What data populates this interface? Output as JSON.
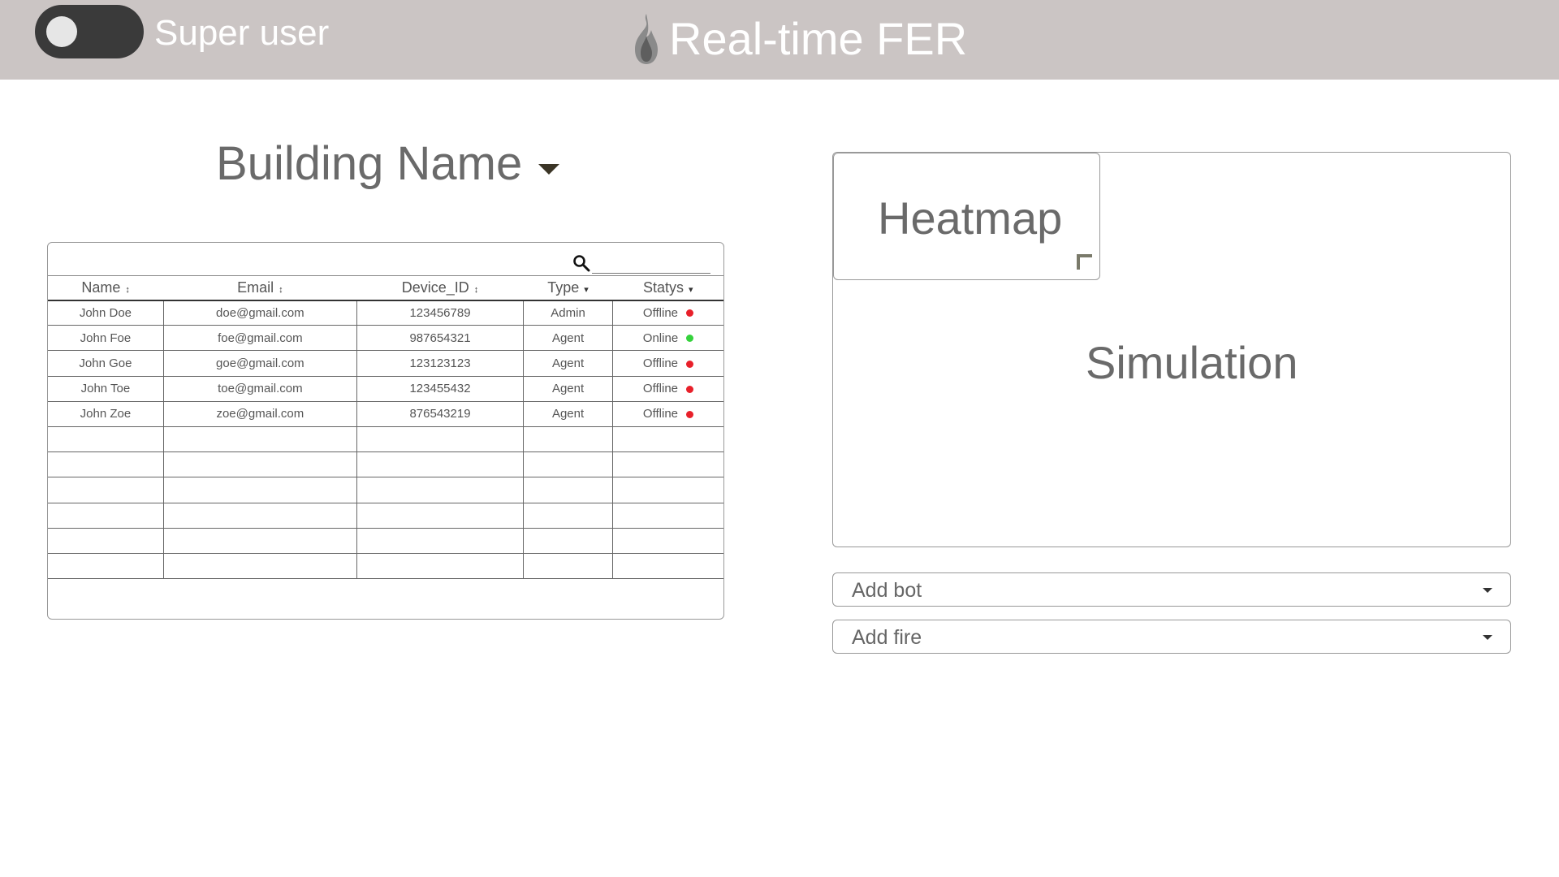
{
  "header": {
    "toggle_label": "Super user",
    "toggle_on": false,
    "app_title": "Real-time FER",
    "logo_icon": "flame-icon"
  },
  "building": {
    "name": "Building Name"
  },
  "table": {
    "search_placeholder": "",
    "columns": [
      "Name",
      "Email",
      "Device_ID",
      "Type",
      "Statys"
    ],
    "sort_indicators": [
      "↕",
      "↕",
      "↕",
      "▾",
      "▾"
    ],
    "rows": [
      {
        "name": "John Doe",
        "email": "doe@gmail.com",
        "device_id": "123456789",
        "type": "Admin",
        "status": "Offline",
        "status_color": "#e8202a"
      },
      {
        "name": "John Foe",
        "email": "foe@gmail.com",
        "device_id": "987654321",
        "type": "Agent",
        "status": "Online",
        "status_color": "#35d23c"
      },
      {
        "name": "John Goe",
        "email": "goe@gmail.com",
        "device_id": "123123123",
        "type": "Agent",
        "status": "Offline",
        "status_color": "#e8202a"
      },
      {
        "name": "John Toe",
        "email": "toe@gmail.com",
        "device_id": "123455432",
        "type": "Agent",
        "status": "Offline",
        "status_color": "#e8202a"
      },
      {
        "name": "John Zoe",
        "email": "zoe@gmail.com",
        "device_id": "876543219",
        "type": "Agent",
        "status": "Offline",
        "status_color": "#e8202a"
      }
    ],
    "empty_rows": 6
  },
  "simulation": {
    "heatmap_label": "Heatmap",
    "simulation_label": "Simulation"
  },
  "dropdowns": {
    "add_bot": "Add bot",
    "add_fire": "Add fire"
  },
  "colors": {
    "header_bg": "#cbc5c4",
    "offline": "#e8202a",
    "online": "#35d23c"
  }
}
